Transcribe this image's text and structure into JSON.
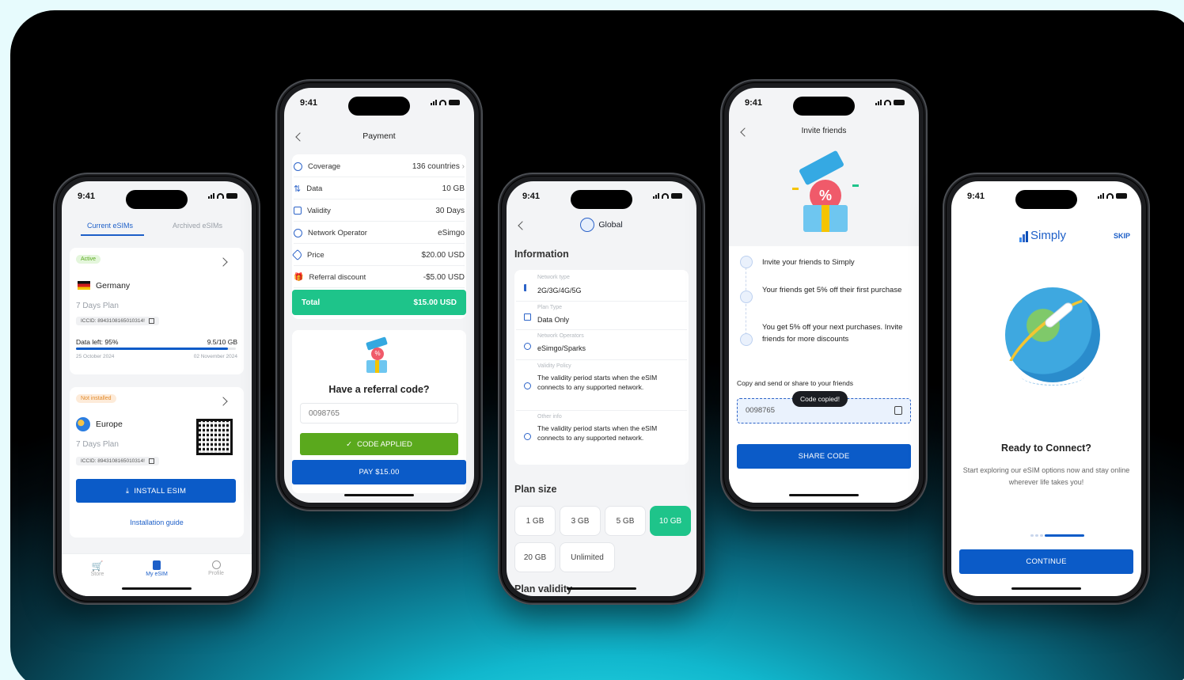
{
  "status_time": "9:41",
  "phone1": {
    "tabs": {
      "current": "Current eSIMs",
      "archived": "Archived eSIMs"
    },
    "esim1": {
      "badge": "Active",
      "country": "Germany",
      "plan": "7 Days Plan",
      "iccid": "ICCID: 8943108165010314!",
      "data_left": "Data left: 95%",
      "usage": "9.5/10 GB",
      "date_start": "25 October 2024",
      "date_end": "02 November 2024",
      "progress": 0.95
    },
    "esim2": {
      "badge": "Not installed",
      "country": "Europe",
      "plan": "7 Days Plan",
      "iccid": "ICCID: 8943108165010314!"
    },
    "install_button": "INSTALL ESIM",
    "guide_link": "Installation guide",
    "nav": {
      "store": "Store",
      "myesim": "My eSIM",
      "profile": "Profile"
    }
  },
  "phone2": {
    "title": "Payment",
    "rows": [
      {
        "key": "Coverage",
        "value": "136 countries"
      },
      {
        "key": "Data",
        "value": "10 GB"
      },
      {
        "key": "Validity",
        "value": "30 Days"
      },
      {
        "key": "Network Operator",
        "value": "eSimgo"
      },
      {
        "key": "Price",
        "value": "$20.00 USD"
      },
      {
        "key": "Referral discount",
        "value": "-$5.00 USD"
      }
    ],
    "total_label": "Total",
    "total_value": "$15.00 USD",
    "referral_title": "Have a referral code?",
    "referral_code": "0098765",
    "applied_button": "CODE APPLIED",
    "pay_button": "PAY $15.00"
  },
  "phone3": {
    "title": "Global",
    "info_heading": "Information",
    "info": [
      {
        "label": "Network type",
        "value": "2G/3G/4G/5G"
      },
      {
        "label": "Plan Type",
        "value": "Data Only"
      },
      {
        "label": "Network Operators",
        "value": "eSimgo/Sparks"
      },
      {
        "label": "Validity Policy",
        "value": "The validity period starts when the eSIM connects to any supported network."
      },
      {
        "label": "Other info",
        "value": "The validity period starts when the eSIM connects to any supported network."
      }
    ],
    "plan_size_heading": "Plan size",
    "sizes": [
      "1 GB",
      "3 GB",
      "5 GB",
      "10 GB",
      "20 GB",
      "Unlimited"
    ],
    "selected_size": "10 GB",
    "plan_validity_heading": "Plan validity"
  },
  "phone4": {
    "title": "Invite friends",
    "steps": [
      "Invite your friends to Simply",
      "Your friends get 5% off their first purchase",
      "You get 5% off your next purchases. Invite friends for more discounts"
    ],
    "copy_hint": "Copy and send or share to your friends",
    "tooltip": "Code copied!",
    "code": "0098765",
    "share_button": "SHARE CODE"
  },
  "phone5": {
    "brand": "Simply",
    "skip": "SKIP",
    "heading": "Ready to Connect?",
    "body": "Start exploring our eSIM options now and stay online wherever life takes you!",
    "continue_button": "CONTINUE"
  },
  "colors": {
    "primary": "#0b5bc8",
    "accent_green": "#1ec48a",
    "applied_green": "#5aa91d"
  }
}
